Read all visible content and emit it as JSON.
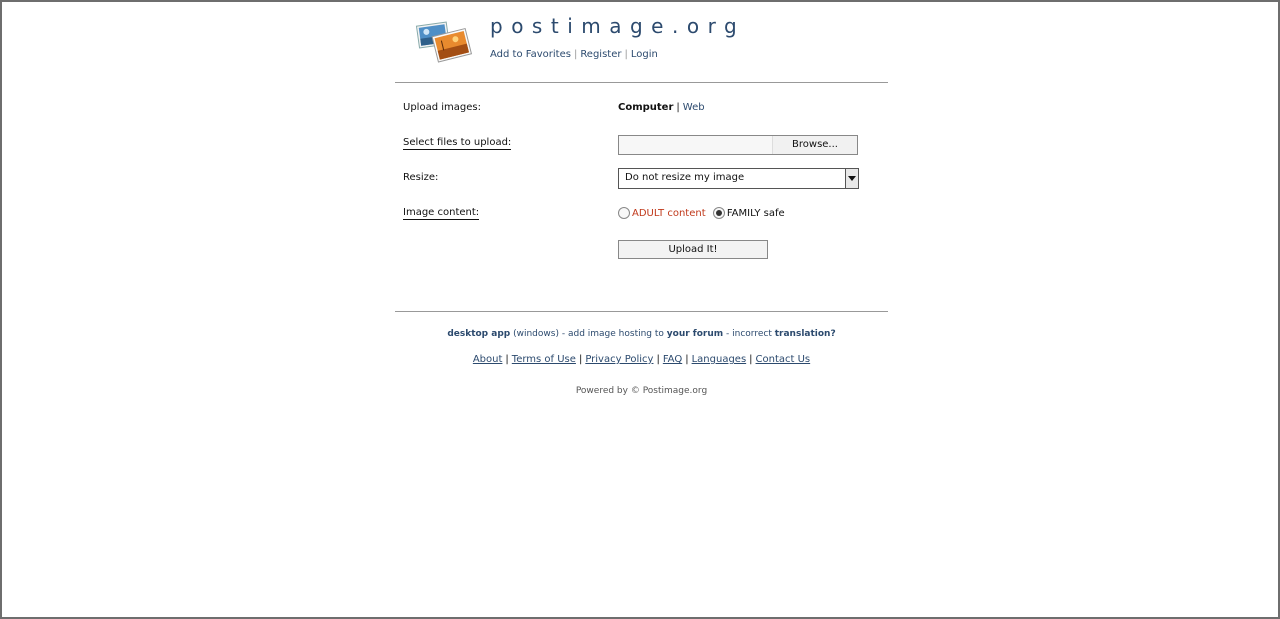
{
  "header": {
    "site_title": "postimage.org",
    "links": [
      "Add to Favorites",
      "Register",
      "Login"
    ]
  },
  "form": {
    "upload_label": "Upload images:",
    "source_tabs": {
      "active": "Computer",
      "other": "Web"
    },
    "select_files_label": "Select files to upload:",
    "browse_label": "Browse...",
    "file_value": "",
    "resize_label": "Resize:",
    "resize_selected": "Do not resize my image",
    "content_label": "Image content:",
    "content_options": {
      "adult": "ADULT content",
      "family": "FAMILY safe",
      "selected": "family"
    },
    "upload_button": "Upload It!"
  },
  "footer": {
    "line1": {
      "desktop_app": "desktop app",
      "windows": "(windows)",
      "sep1": "-",
      "add_hosting": "add image hosting to",
      "your_forum": "your forum",
      "sep2": "-",
      "incorrect": "incorrect",
      "translation": "translation?"
    },
    "links": [
      "About",
      "Terms of Use",
      "Privacy Policy",
      "FAQ",
      "Languages",
      "Contact Us"
    ],
    "powered_by": "Powered by © Postimage.org"
  },
  "colors": {
    "link": "#2c4a6e",
    "adult": "#c0391b",
    "divider": "#999999"
  }
}
